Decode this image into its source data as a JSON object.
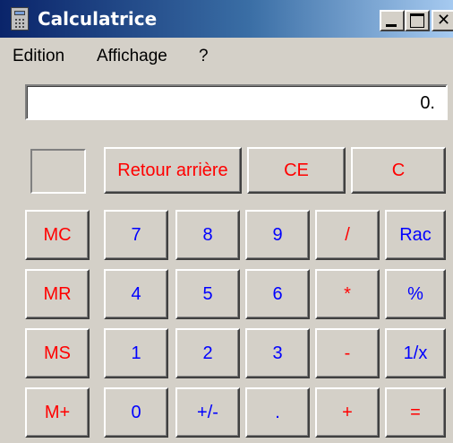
{
  "window": {
    "title": "Calculatrice",
    "controls": [
      "minimize",
      "maximize",
      "close"
    ]
  },
  "menu": {
    "items": [
      "Edition",
      "Affichage",
      "?"
    ]
  },
  "display": {
    "value": "0."
  },
  "colors": {
    "memory_and_control_keys": "#ff0000",
    "digit_keys": "#0000ff",
    "face": "#d4d0c8",
    "titlebar_start": "#0a246a"
  },
  "top_row": [
    "Retour arrière",
    "CE",
    "C"
  ],
  "keypad": [
    [
      "MC",
      "7",
      "8",
      "9",
      "/",
      "Rac"
    ],
    [
      "MR",
      "4",
      "5",
      "6",
      "*",
      "%"
    ],
    [
      "MS",
      "1",
      "2",
      "3",
      "-",
      "1/x"
    ],
    [
      "M+",
      "0",
      "+/-",
      ".",
      "+",
      "="
    ]
  ]
}
